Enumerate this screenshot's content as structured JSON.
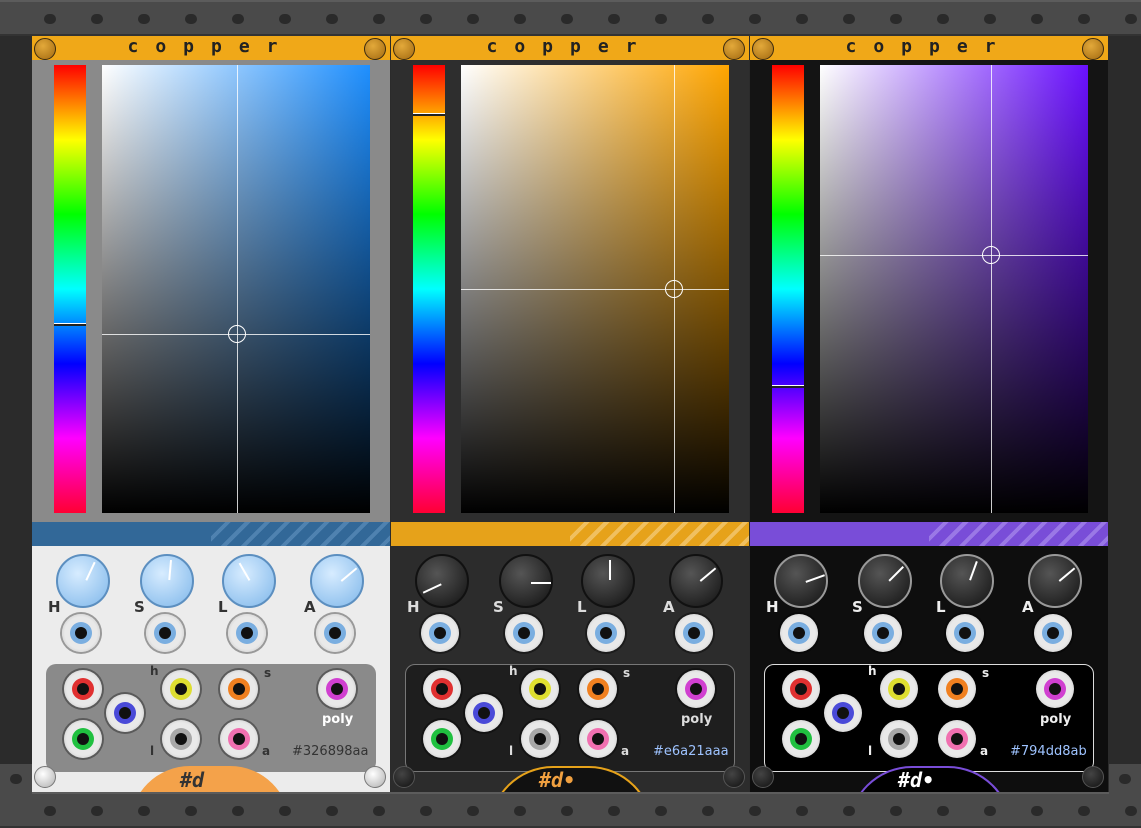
{
  "rack": {
    "rails": "top-and-bottom"
  },
  "modules": [
    {
      "title": "copper",
      "hex": "#326898aa",
      "logo": "#d",
      "theme": "light",
      "color": "#326898",
      "hue_marker_fraction": 0.58,
      "sat_fraction": 0.5,
      "light_fraction": 0.6,
      "knob_labels": [
        "H",
        "S",
        "L",
        "A"
      ],
      "out_labels": {
        "h": "h",
        "s": "s",
        "l": "l",
        "a": "a",
        "poly": "poly"
      }
    },
    {
      "title": "copper",
      "hex": "#e6a21aaa",
      "logo": "#d•",
      "theme": "dark",
      "color": "#e6a21a",
      "hue_marker_fraction": 0.11,
      "sat_fraction": 0.8,
      "light_fraction": 0.5,
      "knob_labels": [
        "H",
        "S",
        "L",
        "A"
      ],
      "out_labels": {
        "h": "h",
        "s": "s",
        "l": "l",
        "a": "a",
        "poly": "poly"
      }
    },
    {
      "title": "copper",
      "hex": "#794dd8ab",
      "logo": "#d•",
      "theme": "black",
      "color": "#794dd8",
      "hue_marker_fraction": 0.72,
      "sat_fraction": 0.65,
      "light_fraction": 0.42,
      "knob_labels": [
        "H",
        "S",
        "L",
        "A"
      ],
      "out_labels": {
        "h": "h",
        "s": "s",
        "l": "l",
        "a": "a",
        "poly": "poly"
      }
    }
  ]
}
